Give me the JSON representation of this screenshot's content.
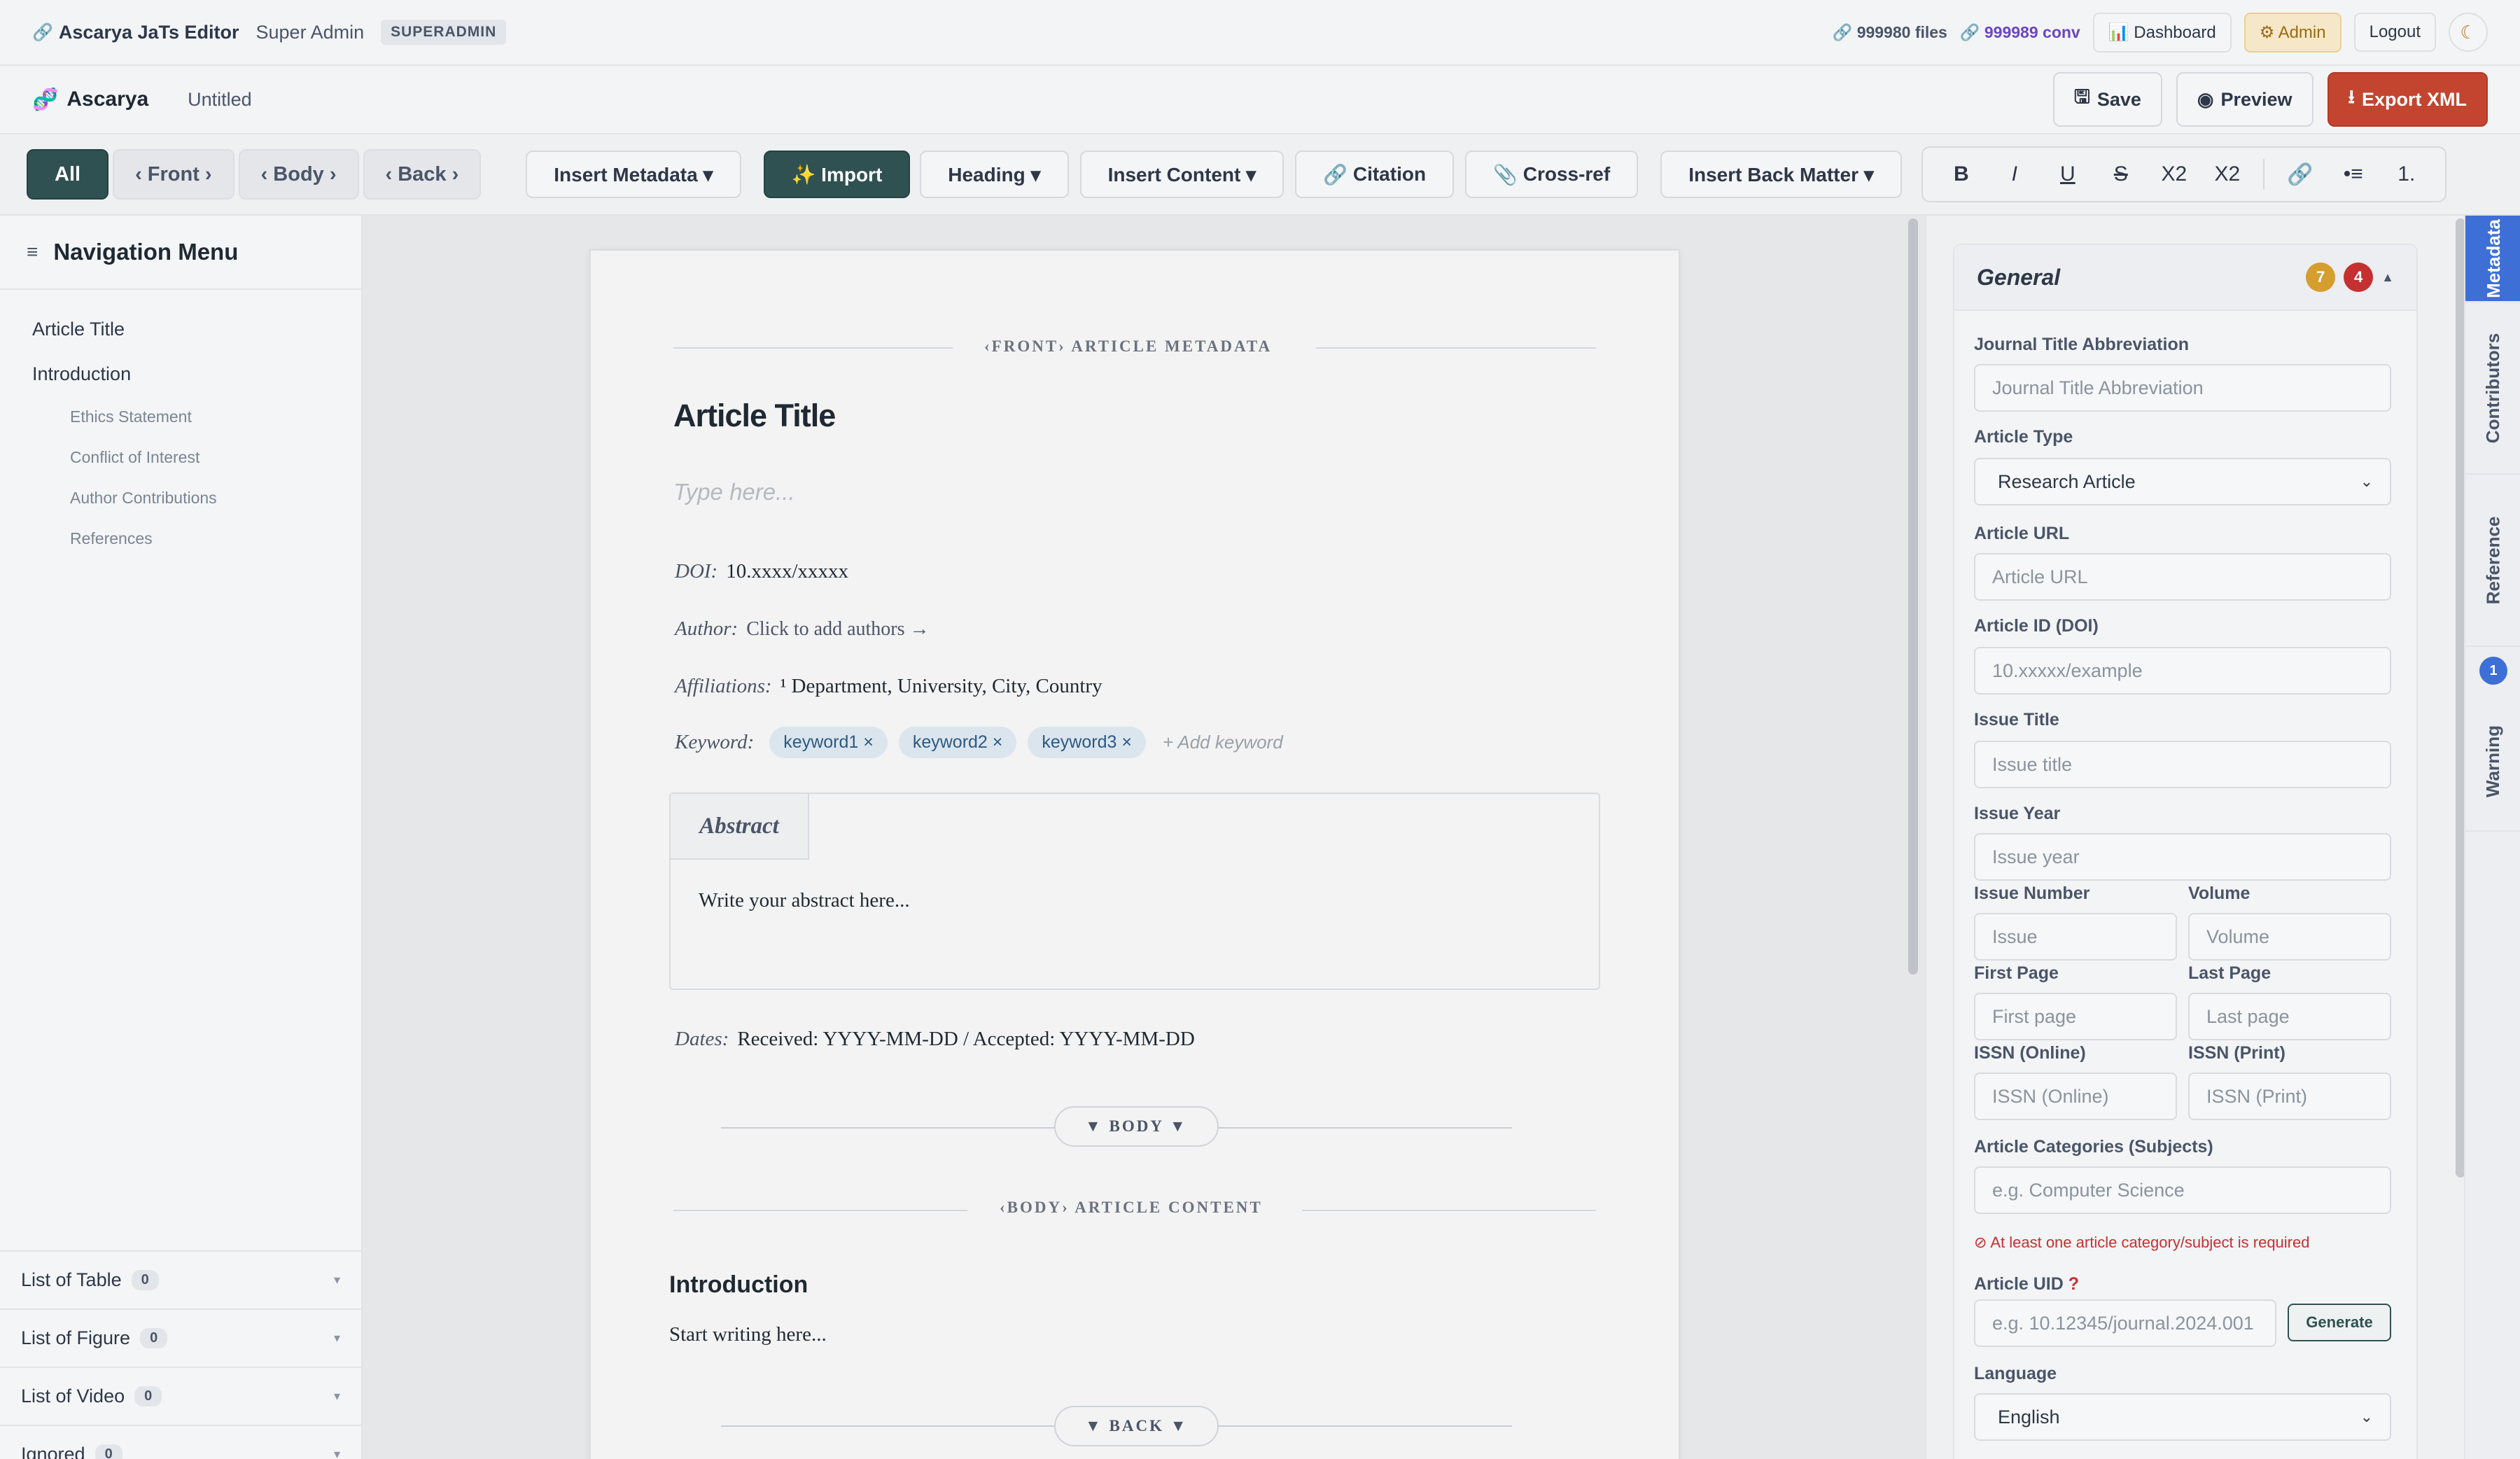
{
  "topbar": {
    "app_title": "Ascarya JaTs Editor",
    "user": "Super Admin",
    "role_badge": "SUPERADMIN",
    "files_stat": "999980 files",
    "conv_stat": "999989 conv",
    "dashboard": "Dashboard",
    "admin": "Admin",
    "logout": "Logout"
  },
  "docbar": {
    "brand": "Ascarya",
    "doc_name": "Untitled",
    "save": "Save",
    "preview": "Preview",
    "export": "Export XML"
  },
  "toolbar": {
    "segments": [
      "All",
      "‹ Front ›",
      "‹ Body ›",
      "‹ Back ›"
    ],
    "insert_metadata": "Insert Metadata ▾",
    "import": "✨ Import",
    "heading": "Heading ▾",
    "insert_content": "Insert Content ▾",
    "citation": "Citation",
    "crossref": "Cross-ref",
    "insert_back": "Insert Back Matter ▾",
    "bold": "B",
    "italic": "I",
    "underline": "U",
    "strike": "S",
    "sub": "X2",
    "sup": "X2",
    "list_num": "1."
  },
  "nav": {
    "title": "Navigation Menu",
    "items": [
      "Article Title",
      "Introduction"
    ],
    "subitems": [
      "Ethics Statement",
      "Conflict of Interest",
      "Author Contributions",
      "References"
    ],
    "lists": [
      {
        "label": "List of Table",
        "count": "0"
      },
      {
        "label": "List of Figure",
        "count": "0"
      },
      {
        "label": "List of Video",
        "count": "0"
      },
      {
        "label": "Ignored",
        "count": "0"
      }
    ]
  },
  "editor": {
    "front_caption": "‹FRONT› ARTICLE METADATA",
    "article_title": "Article Title",
    "title_placeholder": "Type here...",
    "doi_label": "DOI:",
    "doi_value": "10.xxxx/xxxxx",
    "author_label": "Author:",
    "author_value": "Click to add authors →",
    "aff_label": "Affiliations:",
    "aff_value": "¹ Department, University, City, Country",
    "kw_label": "Keyword:",
    "keywords": [
      "keyword1 ×",
      "keyword2 ×",
      "keyword3 ×"
    ],
    "kw_add": "+ Add keyword",
    "abstract_label": "Abstract",
    "abstract_text": "Write your abstract here...",
    "dates_label": "Dates:",
    "dates_value": "Received: YYYY-MM-DD / Accepted: YYYY-MM-DD",
    "body_pill": "▼ BODY ▼",
    "body_caption": "‹BODY› ARTICLE CONTENT",
    "section_heading": "Introduction",
    "body_text": "Start writing here...",
    "back_pill": "▼ BACK ▼"
  },
  "metadata": {
    "section": "General",
    "warn_count": "7",
    "err_count": "4",
    "journal_abbrev_label": "Journal Title Abbreviation",
    "journal_abbrev_ph": "Journal Title Abbreviation",
    "article_type_label": "Article Type",
    "article_type_value": "Research Article",
    "article_url_label": "Article URL",
    "article_url_ph": "Article URL",
    "doi_label": "Article ID (DOI)",
    "doi_ph": "10.xxxxx/example",
    "issue_title_label": "Issue Title",
    "issue_title_ph": "Issue title",
    "issue_year_label": "Issue Year",
    "issue_year_ph": "Issue year",
    "issue_number_label": "Issue Number",
    "issue_ph": "Issue",
    "volume_label": "Volume",
    "volume_ph": "Volume",
    "first_page_label": "First Page",
    "first_page_ph": "First page",
    "last_page_label": "Last Page",
    "last_page_ph": "Last page",
    "issn_online_label": "ISSN (Online)",
    "issn_online_ph": "ISSN (Online)",
    "issn_print_label": "ISSN (Print)",
    "issn_print_ph": "ISSN (Print)",
    "categories_label": "Article Categories (Subjects)",
    "categories_ph": "e.g. Computer Science",
    "categories_error": "At least one article category/subject is required",
    "uid_label": "Article UID",
    "uid_ph": "e.g. 10.12345/journal.2024.001",
    "generate": "Generate",
    "language_label": "Language",
    "language_value": "English"
  },
  "side_tabs": {
    "metadata": "Metadata",
    "contributors": "Contributors",
    "reference": "Reference",
    "reference_badge": "1",
    "warning": "Warning"
  },
  "colors": {
    "accent": "#2f5151",
    "export": "#c4452f",
    "tab_active": "#3d6fd6",
    "warn": "#d69e2e",
    "error": "#c53030"
  }
}
